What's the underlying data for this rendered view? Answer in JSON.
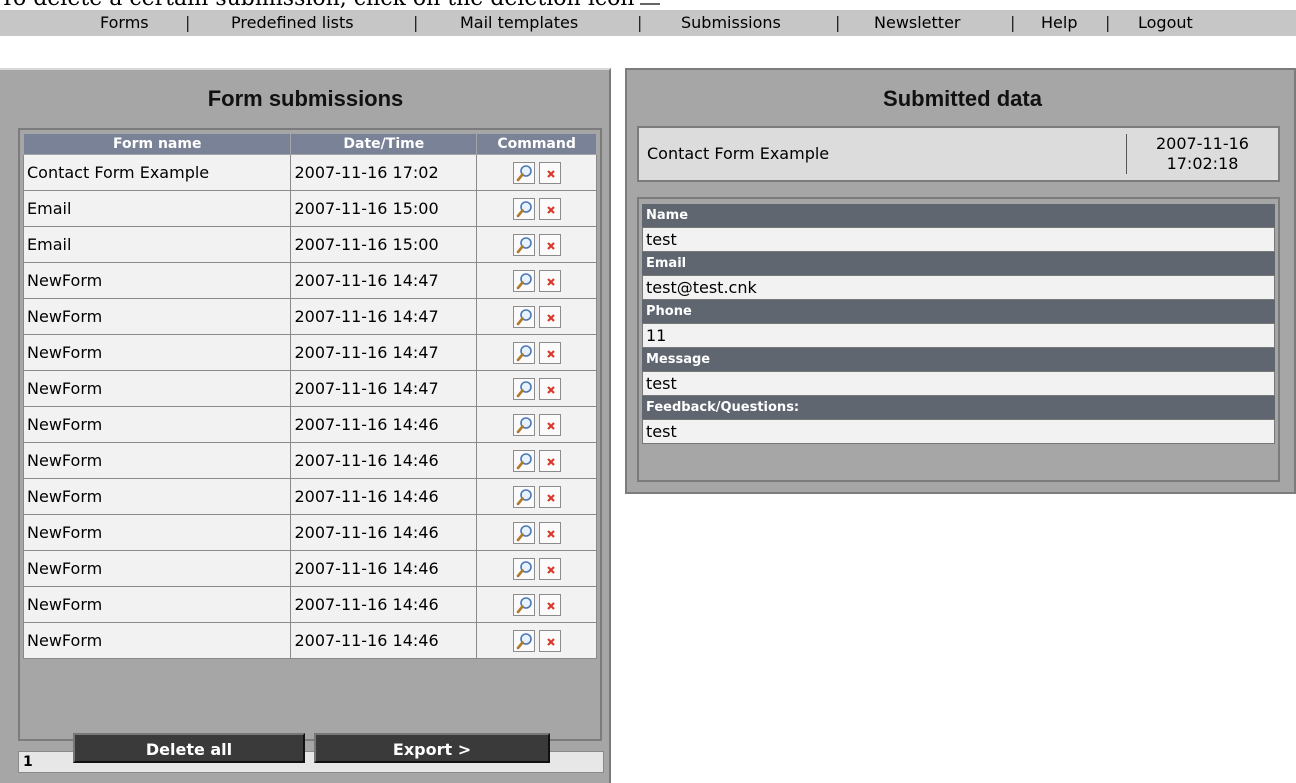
{
  "instruction_text": "To delete a certain submission, click on the deletion icon",
  "nav": {
    "items": [
      "Forms",
      "Predefined lists",
      "Mail templates",
      "Submissions",
      "Newsletter",
      "Help",
      "Logout"
    ],
    "separator": "|"
  },
  "left_panel": {
    "title": "Form submissions",
    "columns": [
      "Form name",
      "Date/Time",
      "Command"
    ],
    "rows": [
      {
        "name": "Contact Form Example",
        "datetime": "2007-11-16 17:02"
      },
      {
        "name": "Email",
        "datetime": "2007-11-16 15:00"
      },
      {
        "name": "Email",
        "datetime": "2007-11-16 15:00"
      },
      {
        "name": "NewForm",
        "datetime": "2007-11-16 14:47"
      },
      {
        "name": "NewForm",
        "datetime": "2007-11-16 14:47"
      },
      {
        "name": "NewForm",
        "datetime": "2007-11-16 14:47"
      },
      {
        "name": "NewForm",
        "datetime": "2007-11-16 14:47"
      },
      {
        "name": "NewForm",
        "datetime": "2007-11-16 14:46"
      },
      {
        "name": "NewForm",
        "datetime": "2007-11-16 14:46"
      },
      {
        "name": "NewForm",
        "datetime": "2007-11-16 14:46"
      },
      {
        "name": "NewForm",
        "datetime": "2007-11-16 14:46"
      },
      {
        "name": "NewForm",
        "datetime": "2007-11-16 14:46"
      },
      {
        "name": "NewForm",
        "datetime": "2007-11-16 14:46"
      },
      {
        "name": "NewForm",
        "datetime": "2007-11-16 14:46"
      }
    ],
    "row_icons": [
      "magnifier-icon",
      "delete-x-icon"
    ],
    "pager": "1",
    "delete_all_label": "Delete all",
    "export_label": "Export >"
  },
  "right_panel": {
    "title": "Submitted data",
    "form_name": "Contact Form Example",
    "date": "2007-11-16",
    "time": "17:02:18",
    "fields": [
      {
        "label": "Name",
        "value": "test"
      },
      {
        "label": "Email",
        "value": "test@test.cnk"
      },
      {
        "label": "Phone",
        "value": "11"
      },
      {
        "label": "Message",
        "value": "test"
      },
      {
        "label": "Feedback/Questions:",
        "value": "test"
      }
    ]
  },
  "colors": {
    "panel_bg": "#a6a6a6",
    "table_header": "#7a8297",
    "field_label": "#5f6670",
    "button_dark": "#3a3a3a",
    "delete_red": "#d83a2a"
  }
}
